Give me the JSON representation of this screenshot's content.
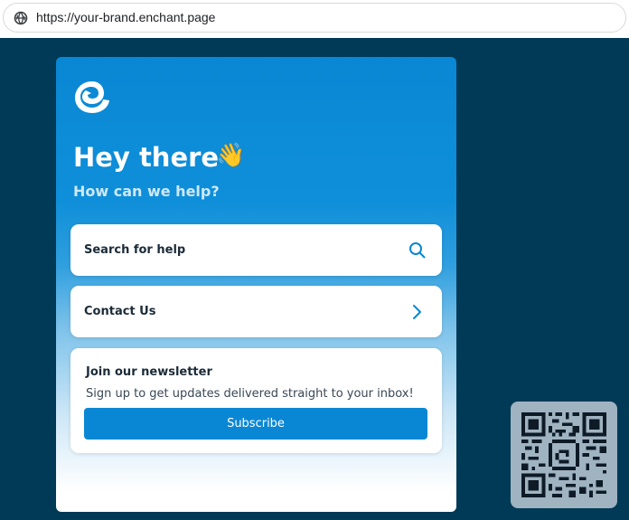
{
  "browser": {
    "url": "https://your-brand.enchant.page",
    "globe_icon": "globe-icon"
  },
  "widget": {
    "logo_icon": "enchant-logo-icon",
    "greeting": "Hey there",
    "greeting_emoji": "👋",
    "subtitle": "How can we help?",
    "search": {
      "label": "Search for help",
      "icon": "search-icon"
    },
    "contact": {
      "label": "Contact Us",
      "icon": "chevron-right-icon"
    },
    "newsletter": {
      "title": "Join our newsletter",
      "text": "Sign up to get updates delivered straight to your inbox!",
      "button": "Subscribe"
    },
    "colors": {
      "accent": "#0a87d4",
      "page_bg": "#003a57",
      "card_text": "#1b2b38"
    }
  },
  "qr_code": {
    "icon": "qr-code-icon"
  }
}
